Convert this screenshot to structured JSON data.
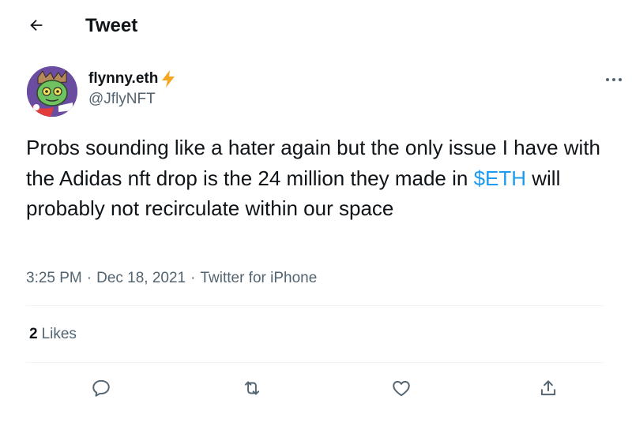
{
  "header": {
    "title": "Tweet",
    "back_icon": "arrow-left-icon"
  },
  "author": {
    "display_name": "flynny.eth",
    "badge_icon": "lightning-bolt-icon",
    "handle": "@JflyNFT",
    "avatar_icon": "zombie-pfp-avatar"
  },
  "tweet": {
    "text_before": "Probs sounding like a hater again but the only issue I have with the Adidas nft drop is the 24 million they made in ",
    "cashtag": "$ETH",
    "text_after": " will probably not recirculate within our space"
  },
  "meta": {
    "time": "3:25 PM",
    "separator_1": "·",
    "date": "Dec 18, 2021",
    "separator_2": "·",
    "source": "Twitter for iPhone"
  },
  "engagement": {
    "likes_count": "2",
    "likes_label": "Likes"
  },
  "actions": [
    "reply-icon",
    "retweet-icon",
    "like-icon",
    "share-icon"
  ],
  "colors": {
    "text": "#0f1419",
    "secondary_text": "#536471",
    "accent": "#1d9bf0",
    "badge": "#f5a623",
    "divider": "#eff3f4"
  }
}
